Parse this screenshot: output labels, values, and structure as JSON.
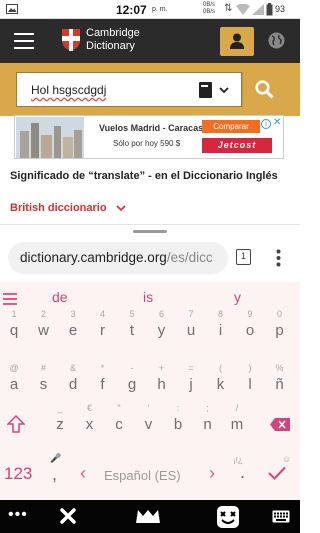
{
  "status": {
    "time": "12:07",
    "ampm": "p. m.",
    "rate_top": "0B/s",
    "rate_bottom": "0B/s",
    "battery": "93"
  },
  "header": {
    "brand_line1": "Cambridge",
    "brand_line2": "Dictionary"
  },
  "search": {
    "query": "Hol hsgscdgdj"
  },
  "ad": {
    "title": "Vuelos Madrid - Caracas",
    "price_text": "Sólo por hoy 590 $",
    "compare_label": "Comparar",
    "brand": "Jetcost"
  },
  "content": {
    "heading": "Significado de “translate” - en el Diccionario Inglés",
    "section_label": "British diccionario"
  },
  "browser": {
    "url_main": "dictionary.cambridge.org",
    "url_rest": "/es/dicc",
    "tab_count": "1"
  },
  "keyboard": {
    "suggestions": [
      "de",
      "is",
      "y"
    ],
    "row1": [
      {
        "k": "q",
        "h": "1"
      },
      {
        "k": "w",
        "h": "2"
      },
      {
        "k": "e",
        "h": "3"
      },
      {
        "k": "r",
        "h": "4"
      },
      {
        "k": "t",
        "h": "5"
      },
      {
        "k": "y",
        "h": "6"
      },
      {
        "k": "u",
        "h": "7"
      },
      {
        "k": "i",
        "h": "8"
      },
      {
        "k": "o",
        "h": "9"
      },
      {
        "k": "p",
        "h": "0"
      }
    ],
    "row2": [
      {
        "k": "a",
        "h": "@"
      },
      {
        "k": "s",
        "h": "#"
      },
      {
        "k": "d",
        "h": "&"
      },
      {
        "k": "f",
        "h": "*"
      },
      {
        "k": "g",
        "h": "-"
      },
      {
        "k": "h",
        "h": "+"
      },
      {
        "k": "j",
        "h": "="
      },
      {
        "k": "k",
        "h": "("
      },
      {
        "k": "l",
        "h": ")"
      },
      {
        "k": "ñ",
        "h": "%"
      }
    ],
    "row3": [
      {
        "k": "z",
        "h": "_"
      },
      {
        "k": "x",
        "h": "€"
      },
      {
        "k": "c",
        "h": "\""
      },
      {
        "k": "v",
        "h": "'"
      },
      {
        "k": "b",
        "h": ":"
      },
      {
        "k": "n",
        "h": ";"
      },
      {
        "k": "m",
        "h": "/"
      }
    ],
    "numbers_key": "123",
    "comma_key": ",",
    "space_label": "Español (ES)",
    "hint_question": "?",
    "hint_exclaim": "¡!¿",
    "period_key": "."
  }
}
